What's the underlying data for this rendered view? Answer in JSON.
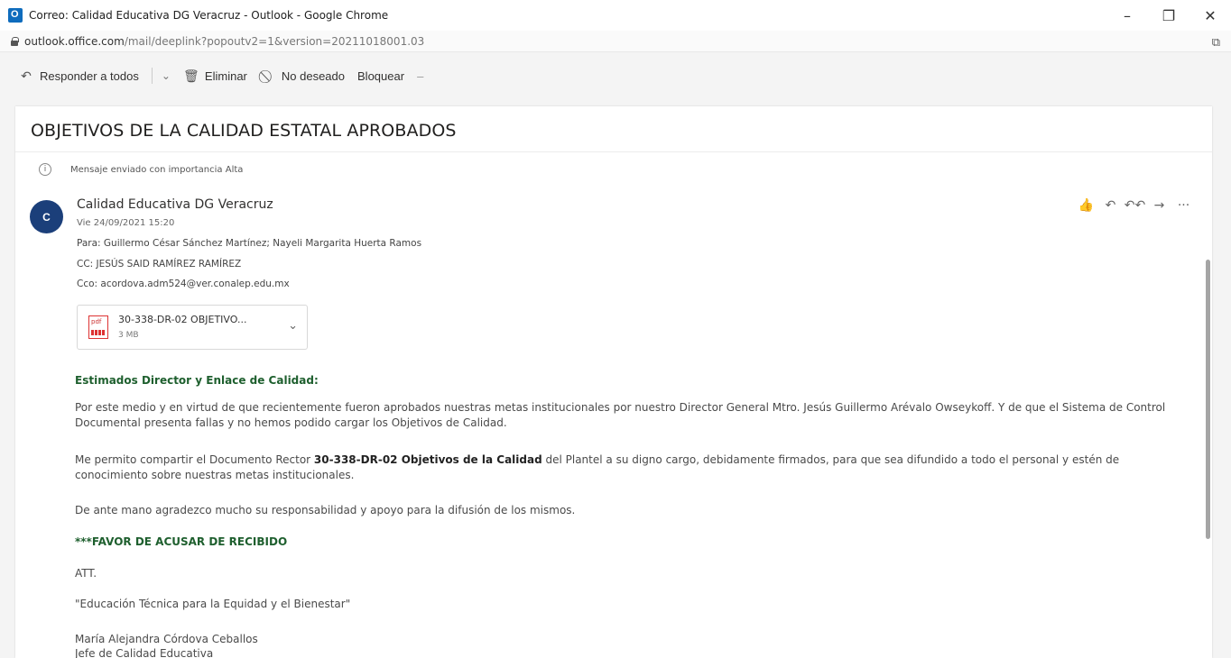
{
  "browser": {
    "title": "Correo: Calidad Educativa DG Veracruz - Outlook - Google Chrome",
    "url_host": "outlook.office.com",
    "url_rest": "/mail/deeplink?popoutv2=1&version=20211018001.03",
    "minimize": "–",
    "maximize": "❐",
    "close": "✕"
  },
  "toolbar": {
    "reply_all": "Responder a todos",
    "delete": "Eliminar",
    "junk": "No deseado",
    "block": "Bloquear",
    "more": "–"
  },
  "message": {
    "subject": "OBJETIVOS DE LA CALIDAD ESTATAL APROBADOS",
    "importance_notice": "Mensaje enviado con importancia Alta",
    "avatar_initial": "C",
    "sender": "Calidad Educativa DG Veracruz",
    "date": "Vie 24/09/2021 15:20",
    "to": "Para: Guillermo César Sánchez Martínez; Nayeli Margarita Huerta Ramos",
    "cc": "CC: JESÚS SAID RAMÍREZ RAMÍREZ",
    "bcc": "Cco: acordova.adm524@ver.conalep.edu.mx",
    "attachment": {
      "name": "30-338-DR-02 OBJETIVO...",
      "size": "3 MB"
    },
    "actions": [
      "👍",
      "↶",
      "↶↶",
      "→",
      "···"
    ],
    "body": {
      "greeting": "Estimados Director y Enlace de Calidad:",
      "p1": "Por este medio y en virtud de que recientemente fueron aprobados nuestras metas institucionales por nuestro Director General Mtro. Jesús Guillermo Arévalo Owseykoff. Y de que el Sistema de Control Documental presenta fallas y no hemos podido cargar los Objetivos de Calidad.",
      "p2_pre": "Me permito compartir el Documento Rector ",
      "p2_bold": "30-338-DR-02 Objetivos de la Calidad",
      "p2_post": " del Plantel a su digno cargo, debidamente firmados, para que sea difundido a todo el personal y estén de conocimiento sobre nuestras metas institucionales.",
      "p3": "De ante mano agradezco mucho su responsabilidad y apoyo para la difusión de los mismos.",
      "ack": "***FAVOR DE ACUSAR DE RECIBIDO",
      "att": "ATT.",
      "motto": "\"Educación Técnica para la Equidad y el Bienestar\"",
      "signer_name": "María Alejandra Córdova Ceballos",
      "signer_title": "Jefe de Calidad Educativa"
    }
  }
}
